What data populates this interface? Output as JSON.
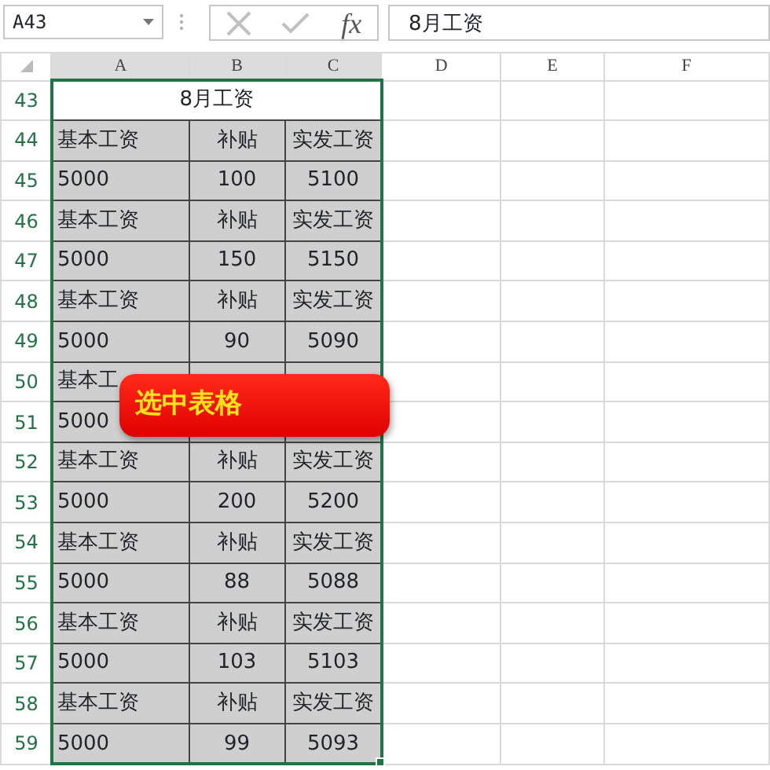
{
  "name_box": "A43",
  "fx_label": "fx",
  "formula": "8月工资",
  "columns": [
    {
      "label": "A",
      "selected": true
    },
    {
      "label": "B",
      "selected": true
    },
    {
      "label": "C",
      "selected": true
    },
    {
      "label": "D",
      "selected": false
    },
    {
      "label": "E",
      "selected": false
    },
    {
      "label": "F",
      "selected": false
    }
  ],
  "rows": [
    {
      "number": "43",
      "selected": true,
      "kind": "title",
      "title": "8月工资"
    },
    {
      "number": "44",
      "selected": true,
      "kind": "cells",
      "cells": [
        "基本工资",
        "补贴",
        "实发工资"
      ]
    },
    {
      "number": "45",
      "selected": true,
      "kind": "cells",
      "cells": [
        "5000",
        "100",
        "5100"
      ]
    },
    {
      "number": "46",
      "selected": true,
      "kind": "cells",
      "cells": [
        "基本工资",
        "补贴",
        "实发工资"
      ]
    },
    {
      "number": "47",
      "selected": true,
      "kind": "cells",
      "cells": [
        "5000",
        "150",
        "5150"
      ]
    },
    {
      "number": "48",
      "selected": true,
      "kind": "cells",
      "cells": [
        "基本工资",
        "补贴",
        "实发工资"
      ]
    },
    {
      "number": "49",
      "selected": true,
      "kind": "cells",
      "cells": [
        "5000",
        "90",
        "5090"
      ]
    },
    {
      "number": "50",
      "selected": true,
      "kind": "cells",
      "cells": [
        "基本工"
      ]
    },
    {
      "number": "51",
      "selected": true,
      "kind": "cells",
      "cells": [
        "5000"
      ]
    },
    {
      "number": "52",
      "selected": true,
      "kind": "cells",
      "cells": [
        "基本工资",
        "补贴",
        "实发工资"
      ]
    },
    {
      "number": "53",
      "selected": true,
      "kind": "cells",
      "cells": [
        "5000",
        "200",
        "5200"
      ]
    },
    {
      "number": "54",
      "selected": true,
      "kind": "cells",
      "cells": [
        "基本工资",
        "补贴",
        "实发工资"
      ]
    },
    {
      "number": "55",
      "selected": true,
      "kind": "cells",
      "cells": [
        "5000",
        "88",
        "5088"
      ]
    },
    {
      "number": "56",
      "selected": true,
      "kind": "cells",
      "cells": [
        "基本工资",
        "补贴",
        "实发工资"
      ]
    },
    {
      "number": "57",
      "selected": true,
      "kind": "cells",
      "cells": [
        "5000",
        "103",
        "5103"
      ]
    },
    {
      "number": "58",
      "selected": true,
      "kind": "cells",
      "cells": [
        "基本工资",
        "补贴",
        "实发工资"
      ]
    },
    {
      "number": "59",
      "selected": true,
      "kind": "cells",
      "cells": [
        "5000",
        "99",
        "5093"
      ]
    }
  ],
  "callout": {
    "text": "选中表格"
  }
}
